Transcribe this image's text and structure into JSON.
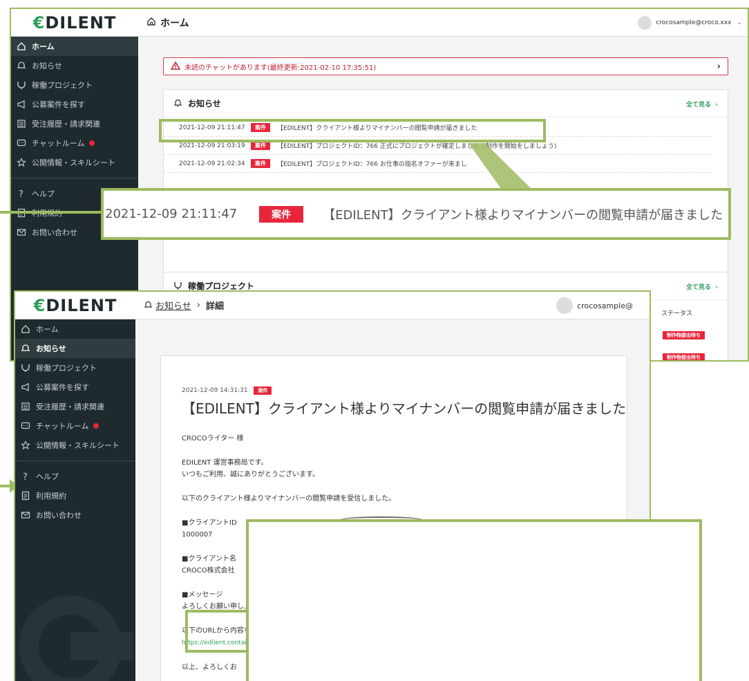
{
  "brand": {
    "logo_mark": "€",
    "logo_text": "DILENT"
  },
  "home": {
    "breadcrumb": "ホーム",
    "user_email": "crocosample@croco.xxx",
    "sidebar": [
      {
        "icon": "home-icon",
        "label": "ホーム",
        "active": true
      },
      {
        "icon": "bell-icon",
        "label": "お知らせ"
      },
      {
        "icon": "fork-icon",
        "label": "稼働プロジェクト"
      },
      {
        "icon": "megaphone-icon",
        "label": "公募案件を探す"
      },
      {
        "icon": "list-icon",
        "label": "受注履歴・請求関連"
      },
      {
        "icon": "chat-icon",
        "label": "チャットルーム",
        "dot": true
      },
      {
        "icon": "star-icon",
        "label": "公開情報・スキルシート"
      },
      {
        "icon": "question-icon",
        "label": "ヘルプ"
      },
      {
        "icon": "document-icon",
        "label": "利用規約"
      },
      {
        "icon": "mail-icon",
        "label": "お問い合わせ"
      }
    ],
    "alert": "未読のチャットがあります(最終更新:2021-02-10 17:35:51)",
    "notices_title": "お知らせ",
    "see_all": "全て見る",
    "notices": [
      {
        "date": "2021-12-09 21:11:47",
        "badge": "案件",
        "text": "【EDILENT】クライアント様よりマイナンバーの閲覧申請が届きました"
      },
      {
        "date": "2021-12-09 21:03:19",
        "badge": "案件",
        "text": "【EDILENT】プロジェクトID：766 正式にプロジェクトが確定しました（制作を開始をしましょう)"
      },
      {
        "date": "2021-12-09 21:02:34",
        "badge": "案件",
        "text": "【EDILENT】プロジェクトID：766 お仕事の指名オファーが来まし"
      }
    ],
    "projects_title": "稼働プロジェクト",
    "status_header": "ステータス",
    "status_badges": [
      "制作物提出待ち",
      "制作物提出待ち"
    ]
  },
  "zoom": {
    "date": "2021-12-09 21:11:47",
    "badge": "案件",
    "text": "【EDILENT】クライアント様よりマイナンバーの閲覧申請が届きました"
  },
  "detail": {
    "breadcrumb_link": "お知らせ",
    "breadcrumb_sep": "›",
    "breadcrumb_current": "詳細",
    "user_email": "crocosample@",
    "sidebar_active": "お知らせ",
    "date": "2021-12-09 14:31:31",
    "badge": "案件",
    "title": "【EDILENT】クライアント様よりマイナンバーの閲覧申請が届きました",
    "greeting": "CROCOライター 様",
    "intro1": "EDILENT 運営事務局です。",
    "intro2": "いつもご利用、誠にありがとうございます。",
    "body": "以下のクライアント様よりマイナンバーの閲覧申請を受信しました。",
    "client_id_label": "■クライアントID",
    "client_id": "1000007",
    "client_name_label": "■クライアント名",
    "client_name": "CROCO株式会社",
    "message_label": "■メッセージ",
    "message": "よろしくお願い申し上げます......",
    "url_label": "以下のURLから内容をご確認できます。",
    "url": "https://edilent.container.dev.cro-co.jp/samplexxxx.com",
    "closing": "以上、よろしくお"
  }
}
